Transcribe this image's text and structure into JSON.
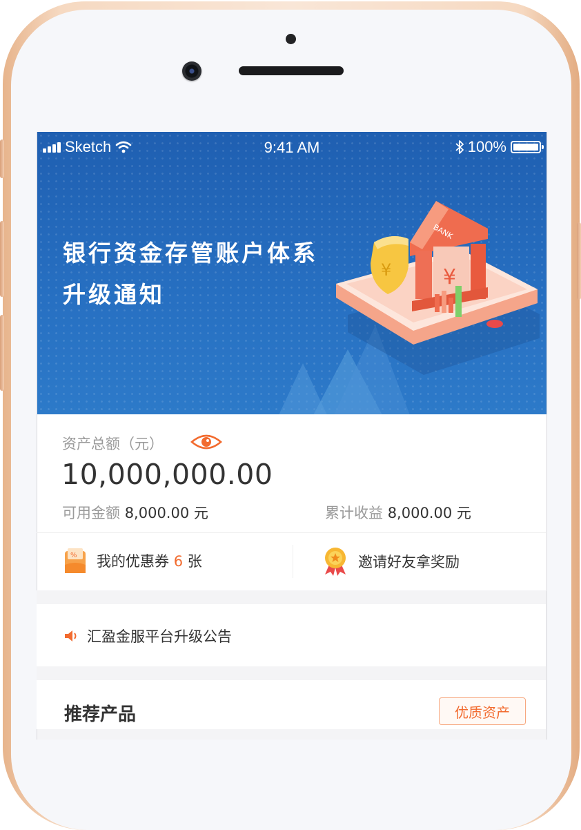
{
  "status_bar": {
    "carrier": "Sketch",
    "time": "9:41 AM",
    "battery": "100%"
  },
  "banner": {
    "title_line1": "银行资金存管账户体系",
    "title_line2": "升级通知",
    "bank_sign": "BANK",
    "yen": "¥"
  },
  "assets": {
    "total_label": "资产总额（元）",
    "total_value": "10,000,000.00",
    "available_label": "可用金额",
    "available_value": "8,000.00 元",
    "cumulative_label": "累计收益",
    "cumulative_value": "8,000.00 元"
  },
  "quick_actions": {
    "coupon_prefix": "我的优惠券",
    "coupon_count": "6",
    "coupon_suffix": "张",
    "invite_label": "邀请好友拿奖励"
  },
  "notice": {
    "text": "汇盈金服平台升级公告"
  },
  "recommend": {
    "title": "推荐产品",
    "tag": "优质资产"
  },
  "colors": {
    "accent": "#f26b2f",
    "banner_blue": "#2770c2",
    "phone_gold": "#f6d9c1"
  }
}
